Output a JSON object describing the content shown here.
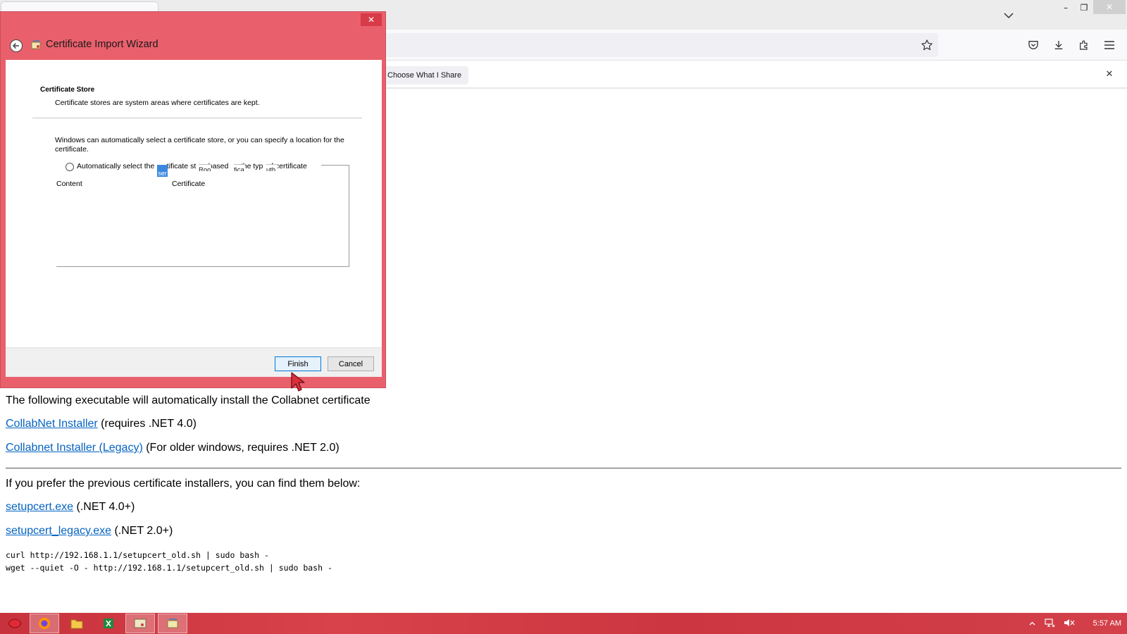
{
  "browser": {
    "notification": {
      "choose_share_label": "Choose What I Share",
      "close_glyph": "✕"
    },
    "window_controls": {
      "minimize": "–",
      "restore": "❐",
      "close": "✕"
    }
  },
  "wizard": {
    "title": "Certificate Import Wizard",
    "close_glyph": "✕",
    "heading": "Certificate Store",
    "description": "Certificate stores are system areas where certificates are kept.",
    "info": "Windows can automatically select a certificate store, or you can specify a location for the certificate.",
    "auto_option": "Automatically select the      tificate st      based      the typ    f certificate",
    "ghost_fragments": [
      "Roo",
      "fica",
      "uth"
    ],
    "selected_fragment": "ser",
    "columns": [
      "Content",
      "Certificate"
    ],
    "buttons": {
      "finish": "Finish",
      "cancel": "Cancel"
    }
  },
  "page": {
    "intro": "The following executable will automatically install the Collabnet certificate",
    "installers": [
      {
        "link": "CollabNet Installer",
        "note": " (requires .NET 4.0)"
      },
      {
        "link": "Collabnet Installer (Legacy)",
        "note": " (For older windows, requires .NET 2.0)"
      }
    ],
    "previous_intro": "If you prefer the previous certificate installers, you can find them below:",
    "previous": [
      {
        "link": "setupcert.exe",
        "note": " (.NET 4.0+)"
      },
      {
        "link": "setupcert_legacy.exe",
        "note": " (.NET 2.0+)"
      }
    ],
    "commands": [
      "curl http://192.168.1.1/setupcert_old.sh | sudo bash -",
      "wget --quiet -O - http://192.168.1.1/setupcert_old.sh | sudo bash -"
    ]
  },
  "taskbar": {
    "clock": "5:57 AM"
  },
  "colors": {
    "wizard_frame": "#e9606c",
    "taskbar": "#d03a44",
    "link": "#0563c1"
  }
}
